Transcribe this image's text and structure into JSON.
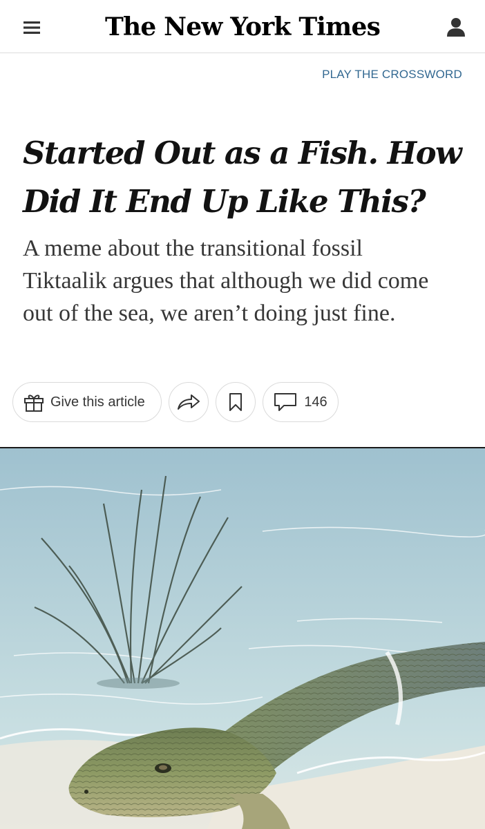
{
  "header": {
    "masthead": "The New York Times",
    "menu_icon": "hamburger-menu-icon",
    "account_icon": "user-account-icon"
  },
  "crossword_link": "PLAY THE CROSSWORD",
  "article": {
    "headline": "Started Out as a Fish. How Did It End Up Like This?",
    "summary": "A meme about the transitional fossil Tiktaalik argues that although we did come out of the sea, we aren’t doing just fine."
  },
  "actions": {
    "gift_label": "Give this article",
    "gift_icon": "gift-icon",
    "share_icon": "share-icon",
    "save_icon": "bookmark-icon",
    "comments_icon": "comment-bubble-icon",
    "comments_count": "146"
  },
  "colors": {
    "link": "#326891",
    "text": "#121212",
    "summary_text": "#363636",
    "border": "#dadada"
  }
}
